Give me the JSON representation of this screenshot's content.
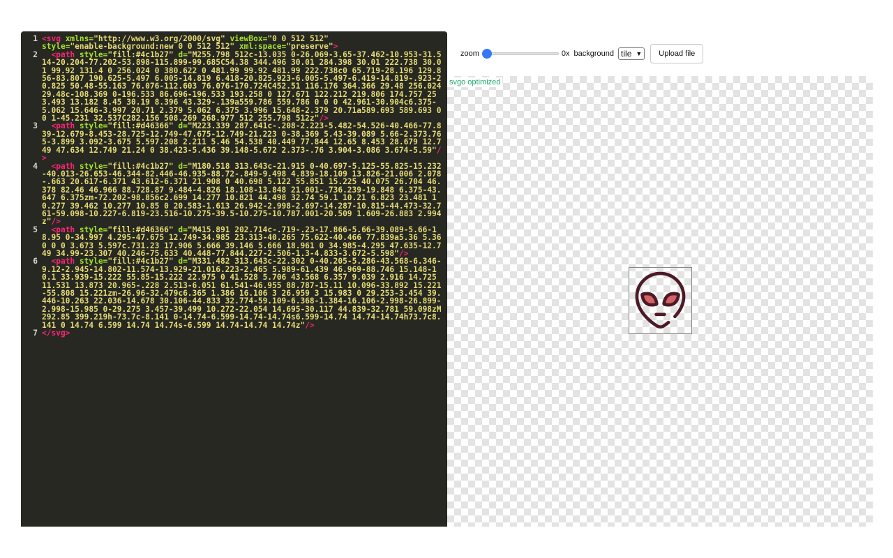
{
  "editor": {
    "lines": [
      {
        "num": "1",
        "parts": [
          {
            "t": "tag",
            "v": "<svg "
          },
          {
            "t": "attr",
            "v": "xmlns="
          },
          {
            "t": "val",
            "v": "\"http://www.w3.org/2000/svg\" "
          },
          {
            "t": "attr",
            "v": "viewBox="
          },
          {
            "t": "val",
            "v": "\"0 0 512 512\"\n"
          },
          {
            "t": "attr",
            "v": "style="
          },
          {
            "t": "val",
            "v": "\"enable-background:new 0 0 512 512\" "
          },
          {
            "t": "attr",
            "v": "xml:space="
          },
          {
            "t": "val",
            "v": "\"preserve\""
          },
          {
            "t": "tag",
            "v": ">"
          }
        ]
      },
      {
        "num": "2",
        "parts": [
          {
            "t": "tag",
            "v": "  <path "
          },
          {
            "t": "attr",
            "v": "style="
          },
          {
            "t": "val",
            "v": "\"fill:#4c1b27\" "
          },
          {
            "t": "attr",
            "v": "d="
          },
          {
            "t": "val",
            "v": "\"M255.798 512c-13.035 0-26.069-3.65-37.462-10.953-31.514-20.204-77.202-53.898-115.899-99.685C54.38 344.496 30.01 284.398 30.01 222.738 30.01 99.92 131.4 0 256.024 0 380.622 0 481.99 99.92 481.99 222.738c0 65.719-28.196 129.856-83.807 190.625-5.497 6.005-14.819 6.418-20.825.923-6.005-5.497-6.419-14.819-.923-20.825 50.48-55.163 76.076-112.603 76.076-170.724C452.51 116.176 364.366 29.48 256.024 29.48c-108.369 0-196.533 86.696-196.533 193.258 0 127.671 122.212 219.806 174.757 253.493 13.182 8.45 30.19 8.396 43.329-.139a559.786 559.786 0 0 0 42.961-30.904c6.375-5.062 15.646-3.997 20.71 2.379 5.062 6.375 3.996 15.648-2.379 20.71a589.693 589.693 0 0 1-45.231 32.537C282.156 508.269 268.977 512 255.798 512z\""
          },
          {
            "t": "tag",
            "v": "/>"
          }
        ]
      },
      {
        "num": "3",
        "parts": [
          {
            "t": "tag",
            "v": "  <path "
          },
          {
            "t": "attr",
            "v": "style="
          },
          {
            "t": "val",
            "v": "\"fill:#d46366\" "
          },
          {
            "t": "attr",
            "v": "d="
          },
          {
            "t": "val",
            "v": "\"M223.339 287.641c-.208-2.223-5.482-54.526-40.466-77.839-12.679-8.453-28.725-12.749-47.675-12.749-21.223 0-38.369 5.43-39.089 5.66-2.373.765-3.899 3.092-3.675 5.597.208 2.211 5.46 54.538 40.449 77.844 12.65 8.453 28.679 12.749 47.634 12.749 21.24 0 38.423-5.436 39.148-5.672 2.373-.76 3.904-3.086 3.674-5.59\""
          },
          {
            "t": "tag",
            "v": "/>"
          }
        ]
      },
      {
        "num": "4",
        "parts": [
          {
            "t": "tag",
            "v": "  <path "
          },
          {
            "t": "attr",
            "v": "style="
          },
          {
            "t": "val",
            "v": "\"fill:#4c1b27\" "
          },
          {
            "t": "attr",
            "v": "d="
          },
          {
            "t": "val",
            "v": "\"M180.518 313.643c-21.915 0-40.697-5.125-55.825-15.232-40.013-26.653-46.344-82.446-46.935-88.72-.849-9.498 4.839-18.109 13.826-21.006 2.078-.663 20.617-6.371 43.612-6.371 21.908 0 40.698 5.122 55.851 15.225 40.075 26.704 46.378 82.46 46.966 88.728.87 9.484-4.826 18.108-13.848 21.001-.736.239-19.848 6.375-43.647 6.375zm-72.202-98.856c2.699 14.277 10.821 44.498 32.74 59.1 10.21 6.823 23.481 10.277 39.462 10.277 10.85 0 20.583-1.613 26.942-2.998-2.697-14.287-10.815-44.473-32.761-59.098-10.227-6.819-23.516-10.275-39.5-10.275-10.787.001-20.509 1.609-26.883 2.994z\""
          },
          {
            "t": "tag",
            "v": "/>"
          }
        ]
      },
      {
        "num": "5",
        "parts": [
          {
            "t": "tag",
            "v": "  <path "
          },
          {
            "t": "attr",
            "v": "style="
          },
          {
            "t": "val",
            "v": "\"fill:#d46366\" "
          },
          {
            "t": "attr",
            "v": "d="
          },
          {
            "t": "val",
            "v": "\"M415.891 202.714c-.719-.23-17.866-5.66-39.089-5.66-18.95 0-34.997 4.295-47.675 12.749-34.985 23.313-40.265 75.622-40.466 77.839a5.36 5.36 0 0 0 3.673 5.597c.731.23 17.906 5.666 39.146 5.666 18.961 0 34.985-4.295 47.635-12.749 34.99-23.307 40.246-75.633 40.448-77.844.227-2.506-1.3-4.833-3.672-5.598\""
          },
          {
            "t": "tag",
            "v": "/>"
          }
        ]
      },
      {
        "num": "6",
        "parts": [
          {
            "t": "tag",
            "v": "  <path "
          },
          {
            "t": "attr",
            "v": "style="
          },
          {
            "t": "val",
            "v": "\"fill:#4c1b27\" "
          },
          {
            "t": "attr",
            "v": "d="
          },
          {
            "t": "val",
            "v": "\"M331.482 313.643c-22.302 0-40.205-5.286-43.568-6.346-9.12-2.945-14.802-11.574-13.929-21.016.223-2.465 5.989-61.439 46.969-88.746 15.148-10.1 33.939-15.222 55.85-15.222 22.975 0 41.528 5.706 43.568 6.357 9.039 2.916 14.725 11.531 13.873 20.965-.228 2.513-6.051 61.541-46.955 88.787-15.11 10.096-33.892 15.221-55.808 15.221zm-26.96-32.479c6.365 1.386 16.106 3 26.959 3 15.983 0 29.253-3.454 39.446-10.263 22.036-14.678 30.106-44.833 32.774-59.109-6.368-1.384-16.106-2.998-26.899-2.998-15.985 0-29.275 3.457-39.499 10.272-22.054 14.695-30.117 44.839-32.781 59.098zM292.85 399.219h-73.7c-8.141 0-14.74-6.599-14.74-14.74s6.599-14.74 14.74-14.74h73.7c8.141 0 14.74 6.599 14.74 14.74s-6.599 14.74-14.74 14.74z\""
          },
          {
            "t": "tag",
            "v": "/>"
          }
        ]
      },
      {
        "num": "7",
        "parts": [
          {
            "t": "tag",
            "v": "</svg>"
          }
        ]
      }
    ]
  },
  "controls": {
    "zoom_label": "zoom",
    "zoom_value": "0x",
    "zoom_slider_fraction": 0.0,
    "background_label": "background",
    "background_selected": "tile",
    "upload_label": "Upload file"
  },
  "preview": {
    "badge": "svgo optimized",
    "icon": "alien-face-icon",
    "colors": {
      "dark": "#4c1b27",
      "accent": "#d46366"
    }
  }
}
